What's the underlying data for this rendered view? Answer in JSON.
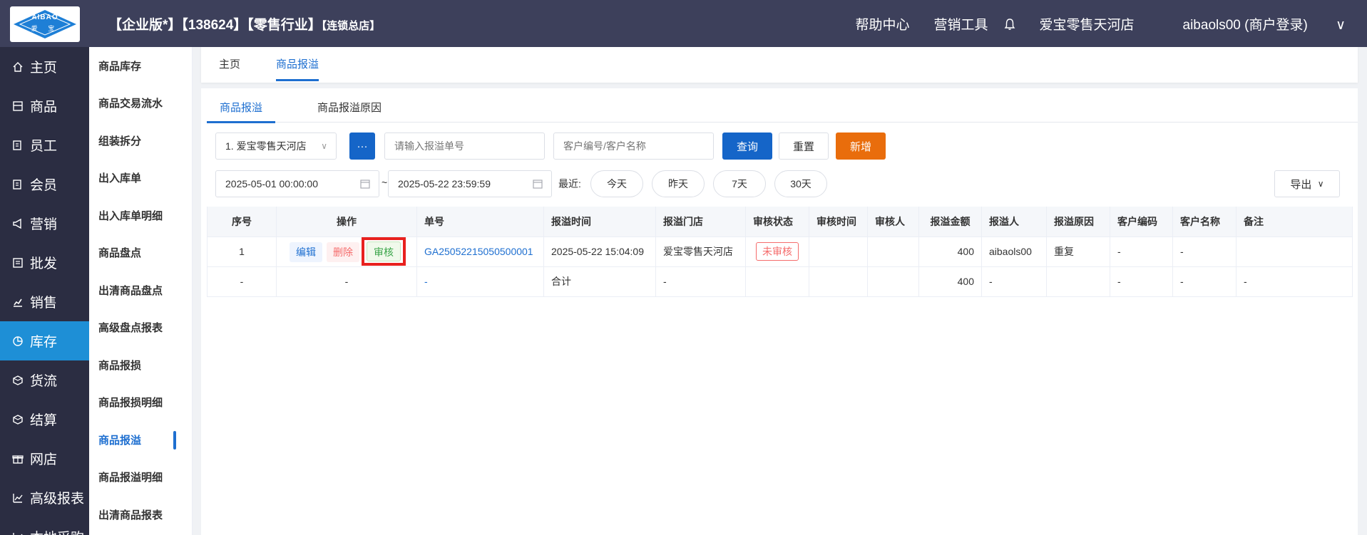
{
  "header": {
    "logo_text_top": "AIBAO",
    "logo_text_bottom": "爱 宝",
    "title_main": "【企业版*】【138624】【零售行业】",
    "title_small": "【连锁总店】",
    "help_center": "帮助中心",
    "marketing_tools": "营销工具",
    "store_name": "爱宝零售天河店",
    "user": "aibaols00 (商户登录)"
  },
  "left_nav": [
    {
      "label": "主页",
      "icon": "home-icon"
    },
    {
      "label": "商品",
      "icon": "goods-icon"
    },
    {
      "label": "员工",
      "icon": "staff-icon"
    },
    {
      "label": "会员",
      "icon": "member-icon"
    },
    {
      "label": "营销",
      "icon": "megaphone-icon"
    },
    {
      "label": "批发",
      "icon": "list-icon"
    },
    {
      "label": "销售",
      "icon": "chart-icon"
    },
    {
      "label": "库存",
      "icon": "pie-icon"
    },
    {
      "label": "货流",
      "icon": "cube-icon"
    },
    {
      "label": "结算",
      "icon": "cube-icon"
    },
    {
      "label": "网店",
      "icon": "gift-icon"
    },
    {
      "label": "高级报表",
      "icon": "line-chart-icon"
    },
    {
      "label": "本地采购",
      "icon": "cart-icon"
    }
  ],
  "sub_nav": [
    "商品库存",
    "商品交易流水",
    "组装拆分",
    "出入库单",
    "出入库单明细",
    "商品盘点",
    "出清商品盘点",
    "高级盘点报表",
    "商品报损",
    "商品报损明细",
    "商品报溢",
    "商品报溢明细",
    "出清商品报表"
  ],
  "tabs": {
    "home": "主页",
    "current": "商品报溢"
  },
  "inner_tabs": {
    "tab1": "商品报溢",
    "tab2": "商品报溢原因"
  },
  "filters": {
    "store_select": "1. 爱宝零售天河店",
    "more_btn": "···",
    "order_no_placeholder": "请输入报溢单号",
    "customer_placeholder": "客户编号/客户名称",
    "query": "查询",
    "reset": "重置",
    "add": "新增",
    "date_start": "2025-05-01 00:00:00",
    "date_sep": "~",
    "date_end": "2025-05-22 23:59:59",
    "recent_label": "最近:",
    "today": "今天",
    "yesterday": "昨天",
    "days7": "7天",
    "days30": "30天",
    "export": "导出"
  },
  "table": {
    "headers": [
      "序号",
      "操作",
      "单号",
      "报溢时间",
      "报溢门店",
      "审核状态",
      "审核时间",
      "审核人",
      "报溢金额",
      "报溢人",
      "报溢原因",
      "客户编码",
      "客户名称",
      "备注"
    ],
    "row": {
      "index": "1",
      "edit": "编辑",
      "delete": "删除",
      "audit": "审核",
      "order_no": "GA25052215050500001",
      "time": "2025-05-22 15:04:09",
      "store": "爱宝零售天河店",
      "status": "未审核",
      "audit_time": "",
      "auditor": "",
      "amount": "400",
      "operator": "aibaols00",
      "reason": "重复",
      "customer_code": "-",
      "customer_name": "-",
      "remark": ""
    },
    "total_row": {
      "index": "-",
      "op": "-",
      "order_no": "-",
      "label": "合计",
      "store": "-",
      "amount": "400",
      "operator": "-",
      "customer_code": "-",
      "customer_name": "-",
      "remark": "-"
    }
  }
}
